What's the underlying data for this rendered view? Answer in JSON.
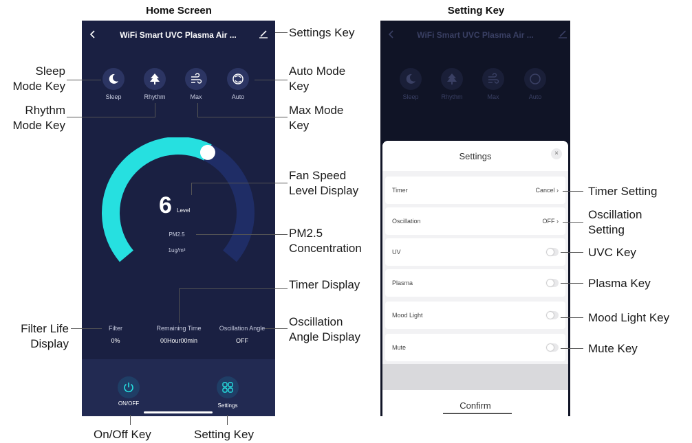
{
  "headings": {
    "home": "Home Screen",
    "setting": "Setting Key"
  },
  "home": {
    "back_icon": "chevron-left-icon",
    "title": "WiFi Smart UVC Plasma Air ...",
    "edit_icon": "pencil-icon",
    "modes": [
      {
        "label": "Sleep",
        "icon": "moon-icon"
      },
      {
        "label": "Rhythm",
        "icon": "tree-icon"
      },
      {
        "label": "Max",
        "icon": "wind-icon"
      },
      {
        "label": "Auto",
        "icon": "cycle-icon"
      }
    ],
    "speed_value": "6",
    "speed_unit": "Level",
    "speed_fraction": 0.6,
    "pm_label": "PM2.5",
    "pm_value": "1ug/m³",
    "info": [
      {
        "head": "Filter",
        "value": "0%"
      },
      {
        "head": "Remaining Time",
        "value": "00Hour00min"
      },
      {
        "head": "Oscillation Angle",
        "value": "OFF"
      }
    ],
    "onoff_label": "ON/OFF",
    "settings_label": "Settings",
    "colors": {
      "background": "#1a2042",
      "accent": "#26e0e0",
      "track": "#1f2d66"
    }
  },
  "settings": {
    "title": "WiFi Smart UVC Plasma Air ...",
    "modes": [
      "Sleep",
      "Rhythm",
      "Max",
      "Auto"
    ],
    "sheet_title": "Settings",
    "close_icon": "close-icon",
    "rows": [
      {
        "label": "Timer",
        "value": "Cancel",
        "type": "link"
      },
      {
        "label": "Oscillation",
        "value": "OFF",
        "type": "link"
      },
      {
        "label": "UV",
        "type": "toggle",
        "on": false
      },
      {
        "label": "Plasma",
        "type": "toggle",
        "on": false
      },
      {
        "label": "Mood Light",
        "type": "toggle",
        "on": false
      },
      {
        "label": "Mute",
        "type": "toggle",
        "on": false
      }
    ],
    "confirm_label": "Confirm"
  },
  "callouts": {
    "settings_key": "Settings Key",
    "sleep_line1": "Sleep",
    "sleep_line2": "Mode Key",
    "auto_line1": "Auto Mode",
    "auto_line2": "Key",
    "rhythm_line1": "Rhythm",
    "rhythm_line2": "Mode Key",
    "max_line1": "Max Mode",
    "max_line2": "Key",
    "fan_line1": "Fan Speed",
    "fan_line2": "Level Display",
    "pm_line1": "PM2.5",
    "pm_line2": "Concentration",
    "timer_display": "Timer Display",
    "filter_line1": "Filter Life",
    "filter_line2": "Display",
    "osc_angle_line1": "Oscillation",
    "osc_angle_line2": "Angle Display",
    "onoff_key": "On/Off Key",
    "setting_key": "Setting Key",
    "timer_setting": "Timer Setting",
    "osc_setting_line1": "Oscillation",
    "osc_setting_line2": "Setting",
    "uvc_key": "UVC Key",
    "plasma_key": "Plasma Key",
    "mood_key": "Mood Light Key",
    "mute_key": "Mute Key"
  }
}
